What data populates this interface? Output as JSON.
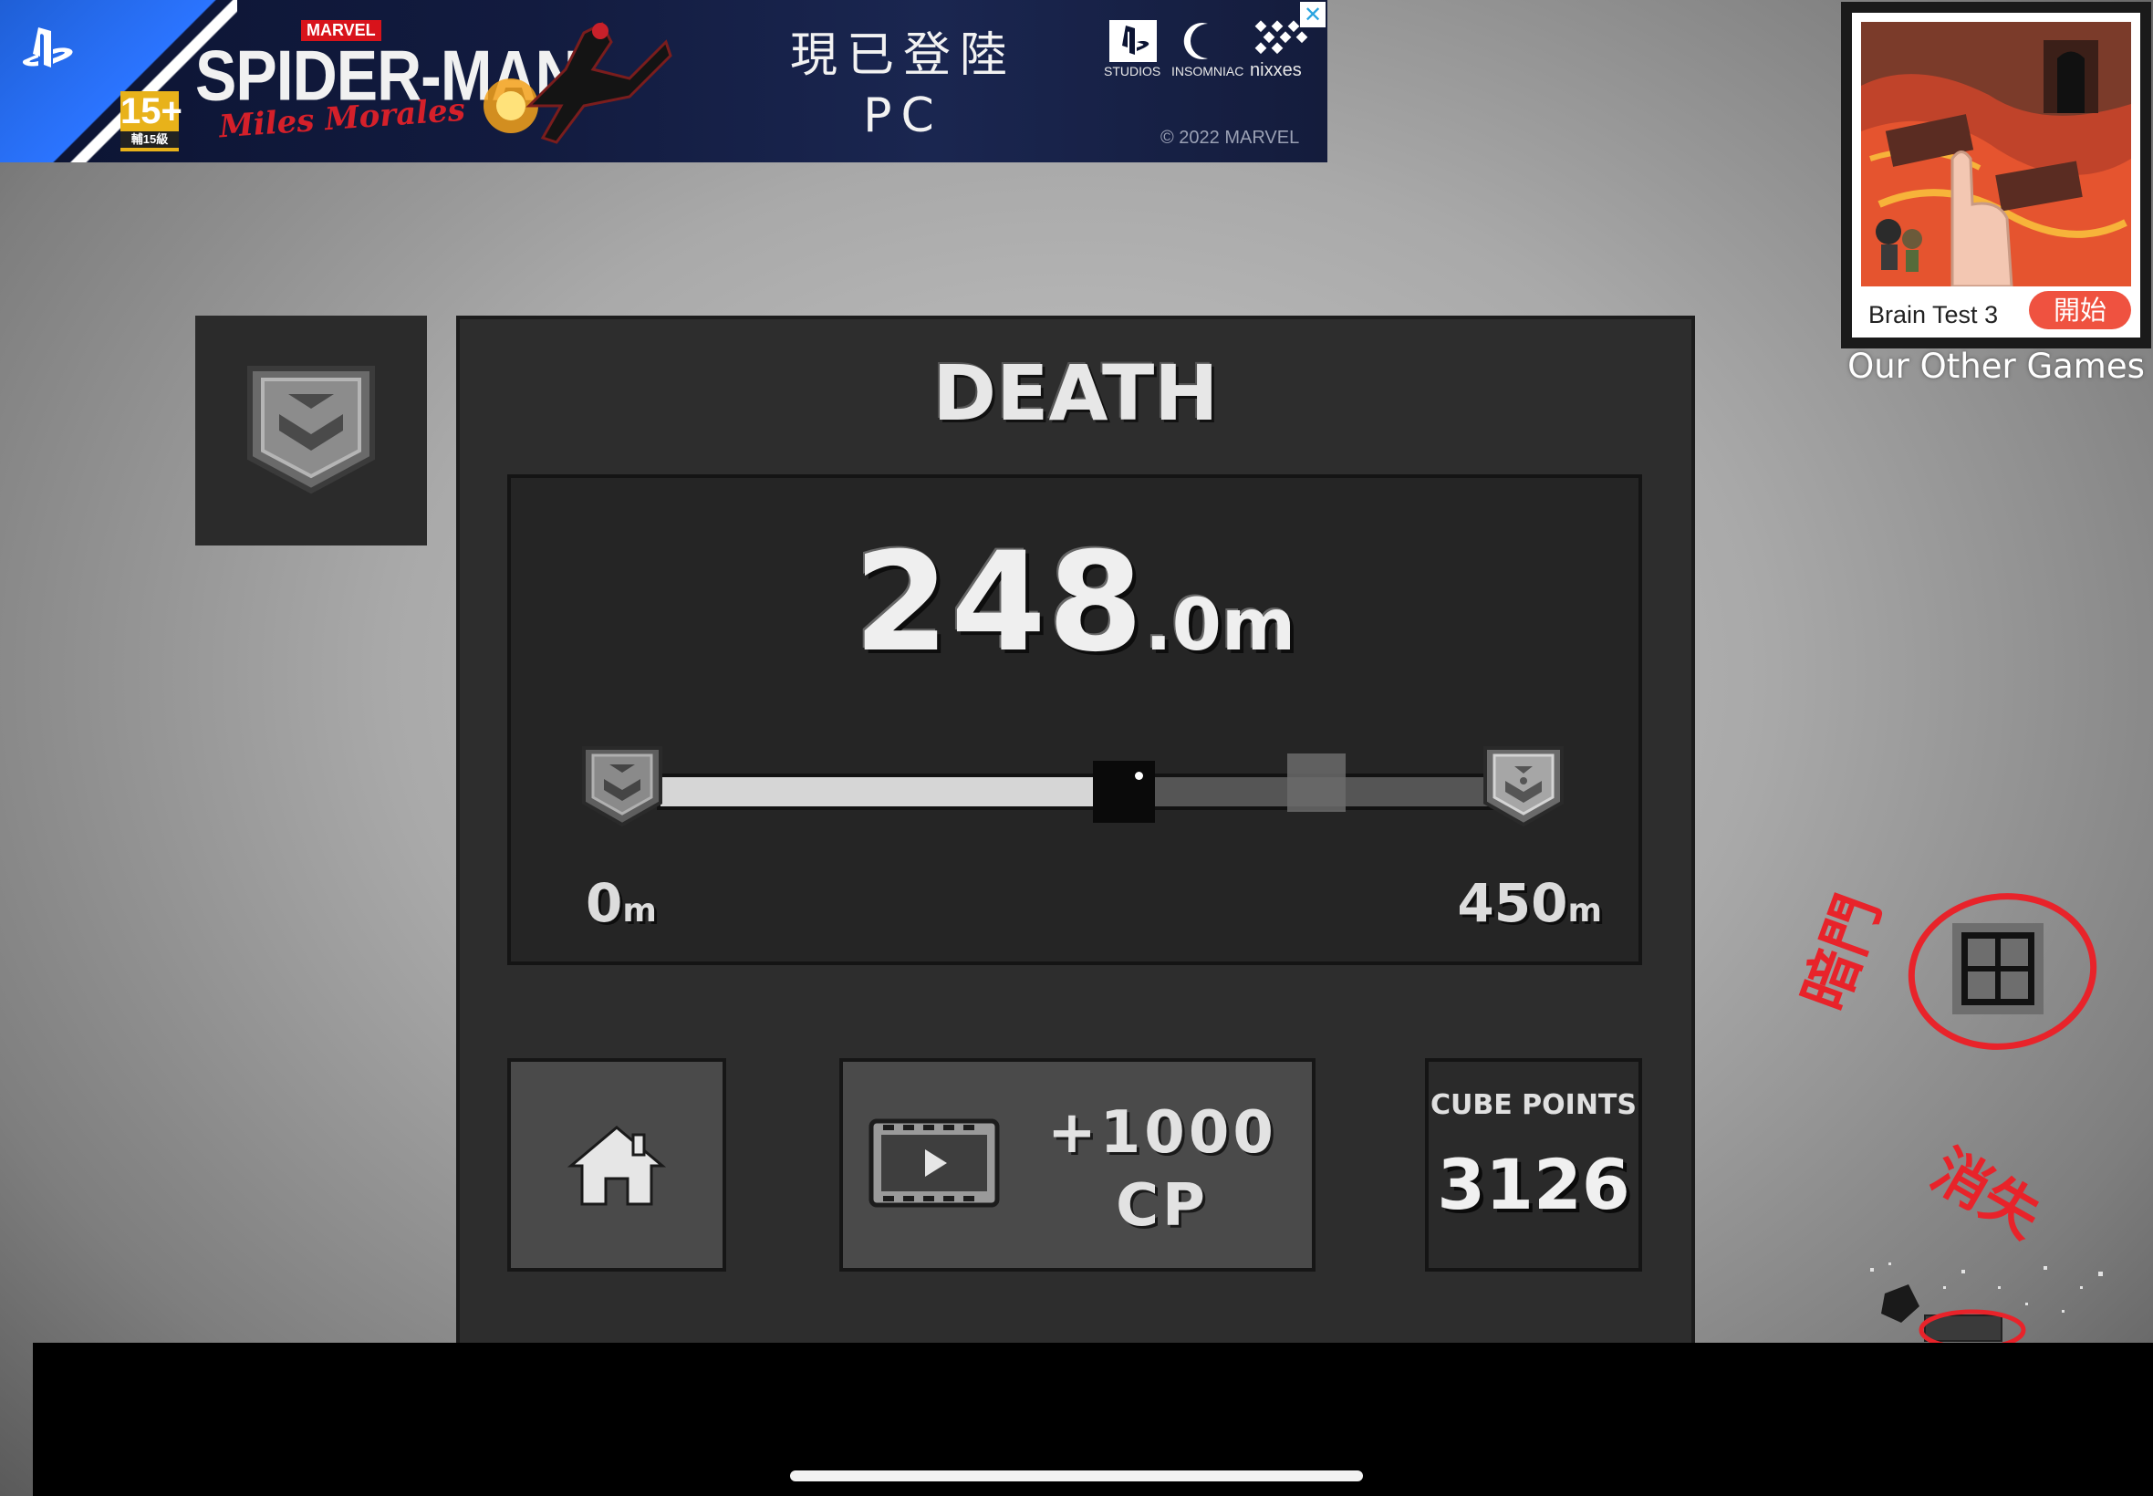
{
  "ad_banner": {
    "age_rating": "15+",
    "age_rating_sub": "輔15級",
    "publisher_tag": "MARVEL",
    "game_title": "SPIDER-MAN",
    "game_subtitle": "Miles Morales",
    "headline_line1": "現已登陸",
    "headline_line2": "PC",
    "studio_labels": [
      "STUDIOS",
      "INSOMNIAC",
      "nixxes"
    ],
    "copyright": "© 2022 MARVEL",
    "close_icon": "close-icon"
  },
  "other_games": {
    "game_name": "Brain Test 3",
    "start_label": "開始",
    "section_label": "Our Other Games"
  },
  "result": {
    "title": "DEATH",
    "distance_int": "248",
    "distance_dec": ".0m",
    "range_start_num": "0",
    "range_start_unit": "m",
    "range_end_num": "450",
    "range_end_unit": "m",
    "progress_fraction": 0.551,
    "best_fraction": 0.78
  },
  "actions": {
    "home_icon": "home-icon",
    "video_icon": "video-play-icon",
    "reward_line1": "+1000",
    "reward_line2": "CP"
  },
  "cube_points": {
    "label": "CUBE POINTS",
    "value": "3126"
  },
  "side_controls": {
    "grid_icon": "grid-icon"
  },
  "annotations": {
    "left_note": "暗門",
    "bottom_note": "消失"
  },
  "colors": {
    "panel_bg": "#2d2d2d",
    "annotation_red": "#e8232a",
    "ad_accent": "#2b74ff",
    "start_button": "#ef5240"
  }
}
